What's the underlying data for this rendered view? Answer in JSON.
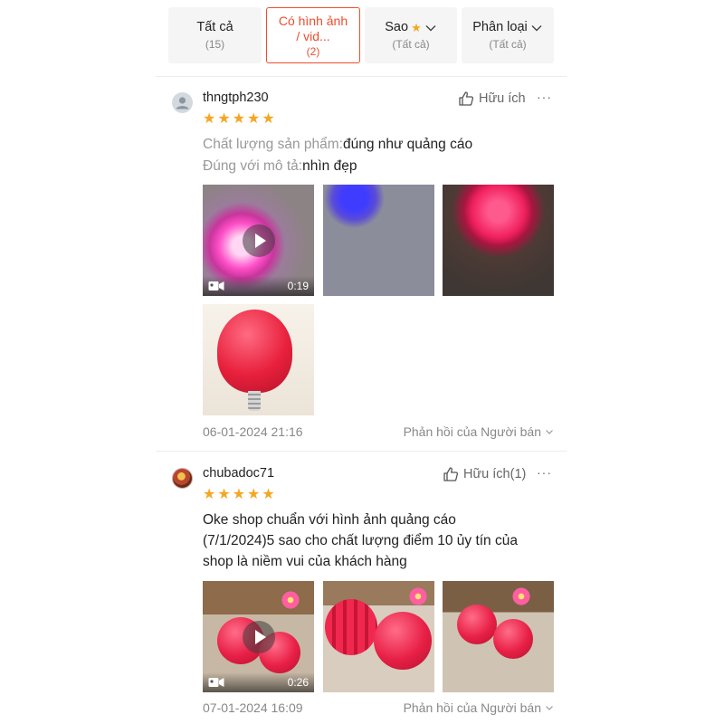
{
  "filters": [
    {
      "label": "Tất cả",
      "count": "(15)"
    },
    {
      "label": "Có hình ảnh / vid...",
      "count": "(2)"
    },
    {
      "label": "Sao",
      "count": "(Tất cả)"
    },
    {
      "label": "Phân loại",
      "count": "(Tất cả)"
    }
  ],
  "accent_color": "#ee4d2d",
  "star_color": "#f5a623",
  "reviews": [
    {
      "username": "thngtph230",
      "helpful_label": "Hữu ích",
      "more": "···",
      "rating": 5,
      "attributes": [
        {
          "key": "Chất lượng sản phẩm:",
          "value": "đúng như quảng cáo"
        },
        {
          "key": "Đúng với mô tả:",
          "value": "nhìn đẹp"
        }
      ],
      "video_duration": "0:19",
      "date": "06-01-2024 21:16",
      "reply_label": "Phản hồi của Người bán"
    },
    {
      "username": "chubadoc71",
      "helpful_label": "Hữu ích(1)",
      "more": "···",
      "rating": 5,
      "text_line1": "Oke shop chuẩn với hình ảnh quảng cáo",
      "text_line2": "(7/1/2024)5 sao cho chất lượng điểm 10 ủy tín của",
      "text_line3": "shop là niềm vui của khách hàng",
      "video_duration": "0:26",
      "date": "07-01-2024 16:09",
      "reply_label": "Phản hồi của Người bán"
    }
  ]
}
